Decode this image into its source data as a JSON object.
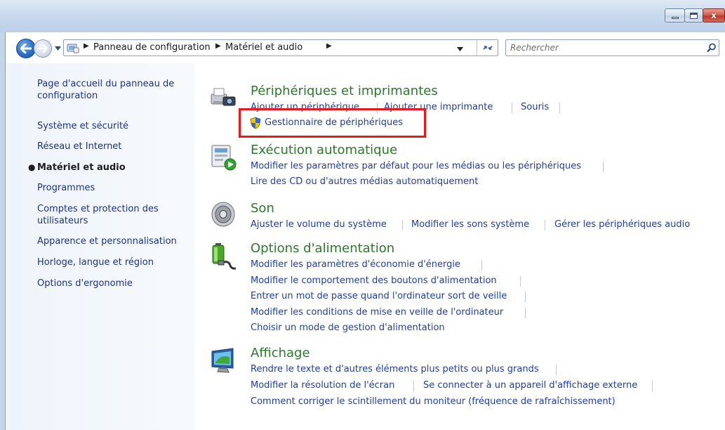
{
  "window": {
    "buttons": {
      "minimize": "minimize-icon",
      "maximize": "maximize-icon",
      "close": "x"
    }
  },
  "navigation": {
    "breadcrumbs": [
      {
        "label": "Panneau de configuration"
      },
      {
        "label": "Matériel et audio"
      }
    ],
    "search_placeholder": "Rechercher"
  },
  "sidebar": {
    "items": [
      {
        "label": "Page d'accueil du panneau de configuration"
      },
      {
        "label": "Système et sécurité"
      },
      {
        "label": "Réseau et Internet"
      },
      {
        "label": "Matériel et audio"
      },
      {
        "label": "Programmes"
      },
      {
        "label": "Comptes et protection des utilisateurs"
      },
      {
        "label": "Apparence et personnalisation"
      },
      {
        "label": "Horloge, langue et région"
      },
      {
        "label": "Options d'ergonomie"
      }
    ],
    "active_index": 3
  },
  "categories": [
    {
      "title": "Périphériques et imprimantes",
      "icon": "printer-camera-icon",
      "links": [
        {
          "label": "Ajouter un périphérique"
        },
        {
          "label": "Ajouter une imprimante"
        },
        {
          "label": "Souris"
        },
        {
          "label": "Gestionnaire de périphériques"
        }
      ]
    },
    {
      "title": "Exécution automatique",
      "icon": "autoplay-icon",
      "links": [
        {
          "label": "Modifier les paramètres par défaut pour les médias ou les périphériques"
        },
        {
          "label": "Lire des CD ou d'autres médias automatiquement"
        }
      ]
    },
    {
      "title": "Son",
      "icon": "speaker-icon",
      "links": [
        {
          "label": "Ajuster le volume du système"
        },
        {
          "label": "Modifier les sons système"
        },
        {
          "label": "Gérer les périphériques audio"
        }
      ]
    },
    {
      "title": "Options d'alimentation",
      "icon": "battery-icon",
      "links": [
        {
          "label": "Modifier les paramètres d'économie d'énergie"
        },
        {
          "label": "Modifier le comportement des boutons d'alimentation"
        },
        {
          "label": "Entrer un mot de passe quand l'ordinateur sort de veille"
        },
        {
          "label": "Modifier les conditions de mise en veille de l'ordinateur"
        },
        {
          "label": "Choisir un mode de gestion d'alimentation"
        }
      ]
    },
    {
      "title": "Affichage",
      "icon": "monitor-icon",
      "links": [
        {
          "label": "Rendre le texte et d'autres éléments plus petits ou plus grands"
        },
        {
          "label": "Modifier la résolution de l'écran"
        },
        {
          "label": "Se connecter à un appareil d'affichage externe"
        },
        {
          "label": "Comment corriger le scintillement du moniteur (fréquence de rafraîchissement)"
        }
      ]
    }
  ],
  "colors": {
    "category_title": "#2a7b2a",
    "link": "#1f3ea8",
    "sidebar_link": "#1e3287",
    "highlight": "#e41b1b"
  }
}
